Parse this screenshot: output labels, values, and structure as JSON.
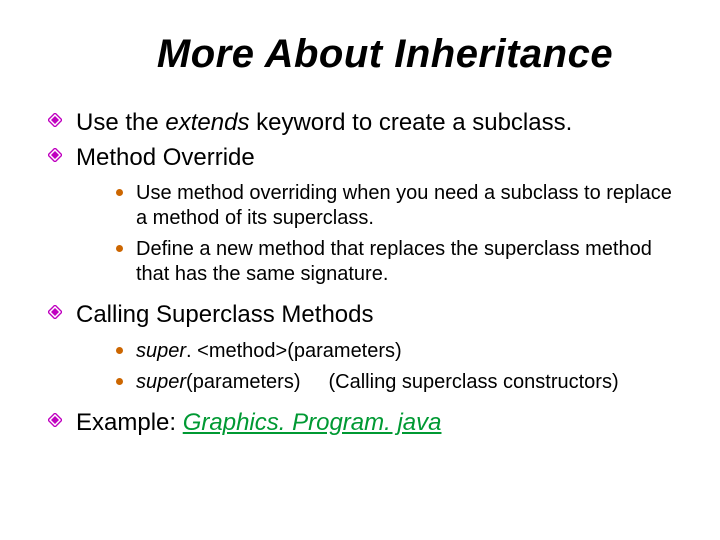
{
  "title": "More About Inheritance",
  "b1_pre": "Use the ",
  "b1_kw": "extends",
  "b1_post": " keyword to create a subclass.",
  "b2": "Method Override",
  "b2_s1": "Use method overriding when you need a subclass to replace a method of its superclass.",
  "b2_s2": "Define a new method that replaces the superclass method that has the same signature.",
  "b3": "Calling Superclass Methods",
  "b3_s1_kw": "super",
  "b3_s1_rest": ". <method>(parameters)",
  "b3_s2_kw": "super",
  "b3_s2_mid": "(parameters)",
  "b3_s2_note": "(Calling superclass constructors)",
  "b4_pre": "Example: ",
  "b4_link": "Graphics. Program. java"
}
